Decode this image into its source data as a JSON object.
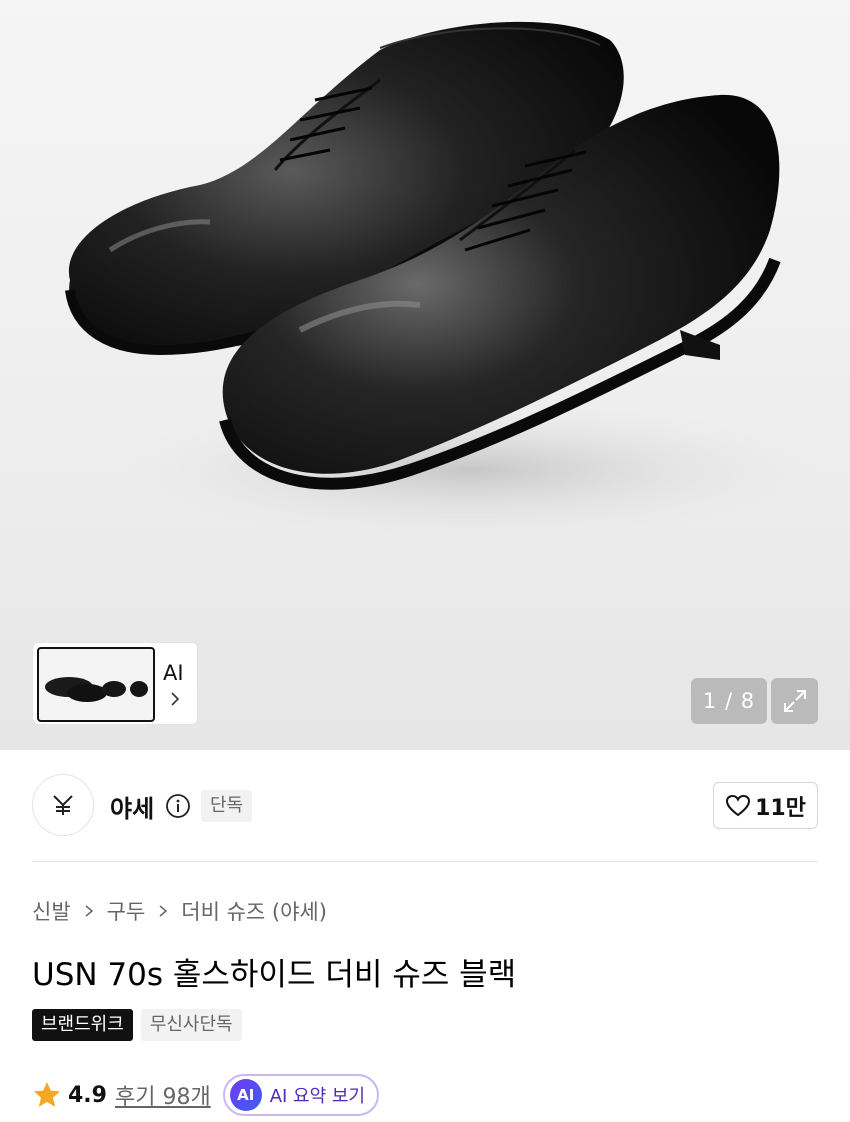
{
  "gallery": {
    "counter": "1 / 8",
    "thumb_ai_label": "AI"
  },
  "brand": {
    "name": "야세",
    "tag": "단독",
    "likes": "11만"
  },
  "breadcrumb": [
    "신발",
    "구두",
    "더비 슈즈 (야세)"
  ],
  "product": {
    "title": "USN 70s 홀스하이드 더비 슈즈 블랙",
    "tags": [
      "브랜드위크",
      "무신사단독"
    ],
    "rating": "4.9",
    "reviews": "후기 98개",
    "ai_summary": "AI 요약 보기",
    "ai_badge": "AI"
  },
  "colors": {
    "accent_purple": "#4f2bb5",
    "star": "#f5a623"
  }
}
